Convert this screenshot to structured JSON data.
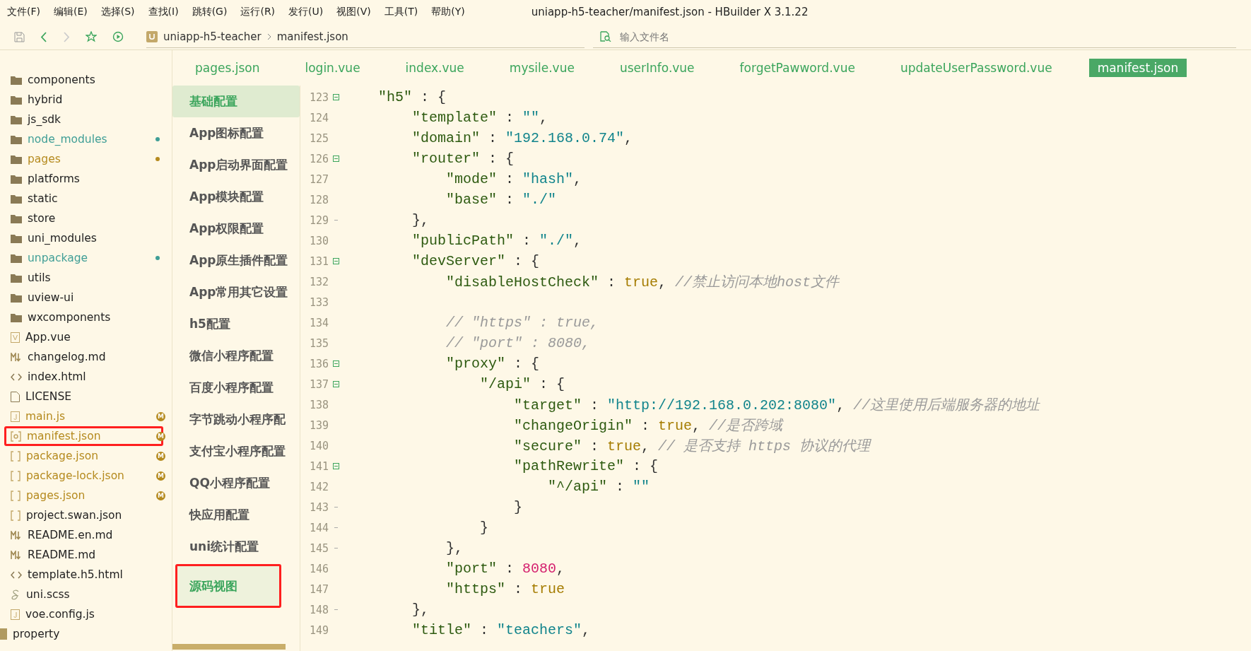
{
  "menu": [
    "文件(F)",
    "编辑(E)",
    "选择(S)",
    "查找(I)",
    "跳转(G)",
    "运行(R)",
    "发行(U)",
    "视图(V)",
    "工具(T)",
    "帮助(Y)"
  ],
  "window": {
    "title": "uniapp-h5-teacher/manifest.json - HBuilder X 3.1.22"
  },
  "toolbar": {
    "forward_disabled": true,
    "breadcrumb": [
      "uniapp-h5-teacher",
      "manifest.json"
    ],
    "file_search": {
      "placeholder": "输入文件名"
    }
  },
  "tabs": [
    {
      "label": "pages.json",
      "selected": false
    },
    {
      "label": "login.vue",
      "selected": false
    },
    {
      "label": "index.vue",
      "selected": false
    },
    {
      "label": "mysile.vue",
      "selected": false
    },
    {
      "label": "userInfo.vue",
      "selected": false
    },
    {
      "label": "forgetPawword.vue",
      "selected": false
    },
    {
      "label": "updateUserPassword.vue",
      "selected": false
    },
    {
      "label": "manifest.json",
      "selected": true
    }
  ],
  "file_tree": [
    {
      "kind": "folder",
      "name": "components",
      "highlighted": false
    },
    {
      "kind": "folder",
      "name": "hybrid",
      "highlighted": false
    },
    {
      "kind": "folder",
      "name": "js_sdk",
      "highlighted": false
    },
    {
      "kind": "folder",
      "name": "node_modules",
      "color": "#3f9e96",
      "highlighted": false
    },
    {
      "kind": "folder",
      "name": "pages",
      "color": "#b58a1e",
      "highlighted": false
    },
    {
      "kind": "folder",
      "name": "platforms",
      "highlighted": false
    },
    {
      "kind": "folder",
      "name": "static",
      "highlighted": false
    },
    {
      "kind": "folder",
      "name": "store",
      "highlighted": false
    },
    {
      "kind": "folder",
      "name": "uni_modules",
      "highlighted": false
    },
    {
      "kind": "folder",
      "name": "unpackage",
      "color": "#3f9e96",
      "highlighted": false
    },
    {
      "kind": "folder",
      "name": "utils",
      "highlighted": false
    },
    {
      "kind": "folder",
      "name": "uview-ui",
      "highlighted": false
    },
    {
      "kind": "folder",
      "name": "wxcomponents",
      "highlighted": false
    },
    {
      "kind": "vue",
      "name": "App.vue",
      "highlighted": false
    },
    {
      "kind": "md",
      "name": "changelog.md",
      "highlighted": false
    },
    {
      "kind": "html",
      "name": "index.html",
      "highlighted": false
    },
    {
      "kind": "text",
      "name": "LICENSE",
      "highlighted": false
    },
    {
      "kind": "js",
      "name": "main.js",
      "color": "#b58a1e",
      "badge": "M",
      "highlighted": false
    },
    {
      "kind": "manifest",
      "name": "manifest.json",
      "color": "#b58a1e",
      "badge": "M",
      "highlighted": true
    },
    {
      "kind": "json",
      "name": "package.json",
      "color": "#b58a1e",
      "badge": "M",
      "highlighted": false
    },
    {
      "kind": "json",
      "name": "package-lock.json",
      "color": "#b58a1e",
      "badge": "M",
      "highlighted": false
    },
    {
      "kind": "json",
      "name": "pages.json",
      "color": "#b58a1e",
      "badge": "M",
      "highlighted": false
    },
    {
      "kind": "json",
      "name": "project.swan.json",
      "highlighted": false
    },
    {
      "kind": "md",
      "name": "README.en.md",
      "highlighted": false
    },
    {
      "kind": "md",
      "name": "README.md",
      "highlighted": false
    },
    {
      "kind": "html",
      "name": "template.h5.html",
      "highlighted": false
    },
    {
      "kind": "scss",
      "name": "uni.scss",
      "highlighted": false
    },
    {
      "kind": "js",
      "name": "voe.config.js",
      "highlighted": false
    }
  ],
  "other_project": {
    "name": "property"
  },
  "settings_nav": [
    {
      "label": "基础配置",
      "hovered": true,
      "selected": false,
      "highlighted": false
    },
    {
      "label": "App图标配置",
      "hovered": false,
      "selected": false,
      "highlighted": false
    },
    {
      "label": "App启动界面配置",
      "hovered": false,
      "selected": false,
      "highlighted": false
    },
    {
      "label": "App模块配置",
      "hovered": false,
      "selected": false,
      "highlighted": false
    },
    {
      "label": "App权限配置",
      "hovered": false,
      "selected": false,
      "highlighted": false
    },
    {
      "label": "App原生插件配置",
      "hovered": false,
      "selected": false,
      "highlighted": false
    },
    {
      "label": "App常用其它设置",
      "hovered": false,
      "selected": false,
      "highlighted": false
    },
    {
      "label": "h5配置",
      "hovered": false,
      "selected": false,
      "highlighted": false
    },
    {
      "label": "微信小程序配置",
      "hovered": false,
      "selected": false,
      "highlighted": false
    },
    {
      "label": "百度小程序配置",
      "hovered": false,
      "selected": false,
      "highlighted": false
    },
    {
      "label": "字节跳动小程序配",
      "hovered": false,
      "selected": false,
      "highlighted": false
    },
    {
      "label": "支付宝小程序配置",
      "hovered": false,
      "selected": false,
      "highlighted": false
    },
    {
      "label": "QQ小程序配置",
      "hovered": false,
      "selected": false,
      "highlighted": false
    },
    {
      "label": "快应用配置",
      "hovered": false,
      "selected": false,
      "highlighted": false
    },
    {
      "label": "uni统计配置",
      "hovered": false,
      "selected": false,
      "highlighted": false
    },
    {
      "label": "源码视图",
      "hovered": false,
      "selected": true,
      "highlighted": true
    }
  ],
  "code_lines": [
    {
      "number": "123",
      "fold_start": true,
      "fold_end": false,
      "tokens": [
        {
          "kind": "key",
          "text": "\"h5\""
        },
        {
          "kind": "punct",
          "text": " : {"
        }
      ]
    },
    {
      "number": "124",
      "fold_start": false,
      "fold_end": false,
      "tokens": [
        {
          "kind": "key",
          "text": "    \"template\""
        },
        {
          "kind": "punct",
          "text": " : "
        },
        {
          "kind": "string",
          "text": "\"\""
        },
        {
          "kind": "punct",
          "text": ","
        }
      ]
    },
    {
      "number": "125",
      "fold_start": false,
      "fold_end": false,
      "tokens": [
        {
          "kind": "key",
          "text": "    \"domain\""
        },
        {
          "kind": "punct",
          "text": " : "
        },
        {
          "kind": "string",
          "text": "\"192.168.0.74\""
        },
        {
          "kind": "punct",
          "text": ","
        }
      ]
    },
    {
      "number": "126",
      "fold_start": true,
      "fold_end": false,
      "tokens": [
        {
          "kind": "key",
          "text": "    \"router\""
        },
        {
          "kind": "punct",
          "text": " : {"
        }
      ]
    },
    {
      "number": "127",
      "fold_start": false,
      "fold_end": false,
      "tokens": [
        {
          "kind": "key",
          "text": "        \"mode\""
        },
        {
          "kind": "punct",
          "text": " : "
        },
        {
          "kind": "string",
          "text": "\"hash\""
        },
        {
          "kind": "punct",
          "text": ","
        }
      ]
    },
    {
      "number": "128",
      "fold_start": false,
      "fold_end": false,
      "tokens": [
        {
          "kind": "key",
          "text": "        \"base\""
        },
        {
          "kind": "punct",
          "text": " : "
        },
        {
          "kind": "string",
          "text": "\"./\""
        }
      ]
    },
    {
      "number": "129",
      "fold_start": false,
      "fold_end": true,
      "tokens": [
        {
          "kind": "punct",
          "text": "    },"
        }
      ]
    },
    {
      "number": "130",
      "fold_start": false,
      "fold_end": false,
      "tokens": [
        {
          "kind": "key",
          "text": "    \"publicPath\""
        },
        {
          "kind": "punct",
          "text": " : "
        },
        {
          "kind": "string",
          "text": "\"./\""
        },
        {
          "kind": "punct",
          "text": ","
        }
      ]
    },
    {
      "number": "131",
      "fold_start": true,
      "fold_end": false,
      "tokens": [
        {
          "kind": "key",
          "text": "    \"devServer\""
        },
        {
          "kind": "punct",
          "text": " : {"
        }
      ]
    },
    {
      "number": "132",
      "fold_start": false,
      "fold_end": false,
      "tokens": [
        {
          "kind": "key",
          "text": "        \"disableHostCheck\""
        },
        {
          "kind": "punct",
          "text": " : "
        },
        {
          "kind": "bool",
          "text": "true"
        },
        {
          "kind": "punct",
          "text": ", "
        },
        {
          "kind": "comment",
          "text": "//禁止访问本地host文件"
        }
      ]
    },
    {
      "number": "133",
      "fold_start": false,
      "fold_end": false
    },
    {
      "number": "134",
      "fold_start": false,
      "fold_end": false,
      "tokens": [
        {
          "kind": "comment",
          "text": "        // \"https\" : true,"
        }
      ]
    },
    {
      "number": "135",
      "fold_start": false,
      "fold_end": false,
      "tokens": [
        {
          "kind": "comment",
          "text": "        // \"port\" : 8080,"
        }
      ]
    },
    {
      "number": "136",
      "fold_start": true,
      "fold_end": false,
      "tokens": [
        {
          "kind": "key",
          "text": "        \"proxy\""
        },
        {
          "kind": "punct",
          "text": " : {"
        }
      ]
    },
    {
      "number": "137",
      "fold_start": true,
      "fold_end": false,
      "tokens": [
        {
          "kind": "key",
          "text": "            \"/api\""
        },
        {
          "kind": "punct",
          "text": " : {"
        }
      ]
    },
    {
      "number": "138",
      "fold_start": false,
      "fold_end": false,
      "tokens": [
        {
          "kind": "key",
          "text": "                \"target\""
        },
        {
          "kind": "punct",
          "text": " : "
        },
        {
          "kind": "string",
          "text": "\"http://192.168.0.202:8080\""
        },
        {
          "kind": "punct",
          "text": ", "
        },
        {
          "kind": "comment",
          "text": "//这里使用后端服务器的地址"
        }
      ]
    },
    {
      "number": "139",
      "fold_start": false,
      "fold_end": false,
      "tokens": [
        {
          "kind": "key",
          "text": "                \"changeOrigin\""
        },
        {
          "kind": "punct",
          "text": " : "
        },
        {
          "kind": "bool",
          "text": "true"
        },
        {
          "kind": "punct",
          "text": ", "
        },
        {
          "kind": "comment",
          "text": "//是否跨域"
        }
      ]
    },
    {
      "number": "140",
      "fold_start": false,
      "fold_end": false,
      "tokens": [
        {
          "kind": "key",
          "text": "                \"secure\""
        },
        {
          "kind": "punct",
          "text": " : "
        },
        {
          "kind": "bool",
          "text": "true"
        },
        {
          "kind": "punct",
          "text": ", "
        },
        {
          "kind": "comment",
          "text": "// 是否支持 https 协议的代理"
        }
      ]
    },
    {
      "number": "141",
      "fold_start": true,
      "fold_end": false,
      "tokens": [
        {
          "kind": "key",
          "text": "                \"pathRewrite\""
        },
        {
          "kind": "punct",
          "text": " : {"
        }
      ]
    },
    {
      "number": "142",
      "fold_start": false,
      "fold_end": false,
      "tokens": [
        {
          "kind": "key",
          "text": "                    \"^/api\""
        },
        {
          "kind": "punct",
          "text": " : "
        },
        {
          "kind": "string",
          "text": "\"\""
        }
      ]
    },
    {
      "number": "143",
      "fold_start": false,
      "fold_end": true,
      "tokens": [
        {
          "kind": "punct",
          "text": "                }"
        }
      ]
    },
    {
      "number": "144",
      "fold_start": false,
      "fold_end": true,
      "tokens": [
        {
          "kind": "punct",
          "text": "            }"
        }
      ]
    },
    {
      "number": "145",
      "fold_start": false,
      "fold_end": true,
      "tokens": [
        {
          "kind": "punct",
          "text": "        },"
        }
      ]
    },
    {
      "number": "146",
      "fold_start": false,
      "fold_end": false,
      "tokens": [
        {
          "kind": "key",
          "text": "        \"port\""
        },
        {
          "kind": "punct",
          "text": " : "
        },
        {
          "kind": "number",
          "text": "8080"
        },
        {
          "kind": "punct",
          "text": ","
        }
      ]
    },
    {
      "number": "147",
      "fold_start": false,
      "fold_end": false,
      "tokens": [
        {
          "kind": "key",
          "text": "        \"https\""
        },
        {
          "kind": "punct",
          "text": " : "
        },
        {
          "kind": "bool",
          "text": "true"
        }
      ]
    },
    {
      "number": "148",
      "fold_start": false,
      "fold_end": true,
      "tokens": [
        {
          "kind": "punct",
          "text": "    },"
        }
      ]
    },
    {
      "number": "149",
      "fold_start": false,
      "fold_end": false,
      "tokens": [
        {
          "kind": "key",
          "text": "    \"title\""
        },
        {
          "kind": "punct",
          "text": " : "
        },
        {
          "kind": "string",
          "text": "\"teachers\""
        },
        {
          "kind": "punct",
          "text": ","
        }
      ]
    }
  ]
}
